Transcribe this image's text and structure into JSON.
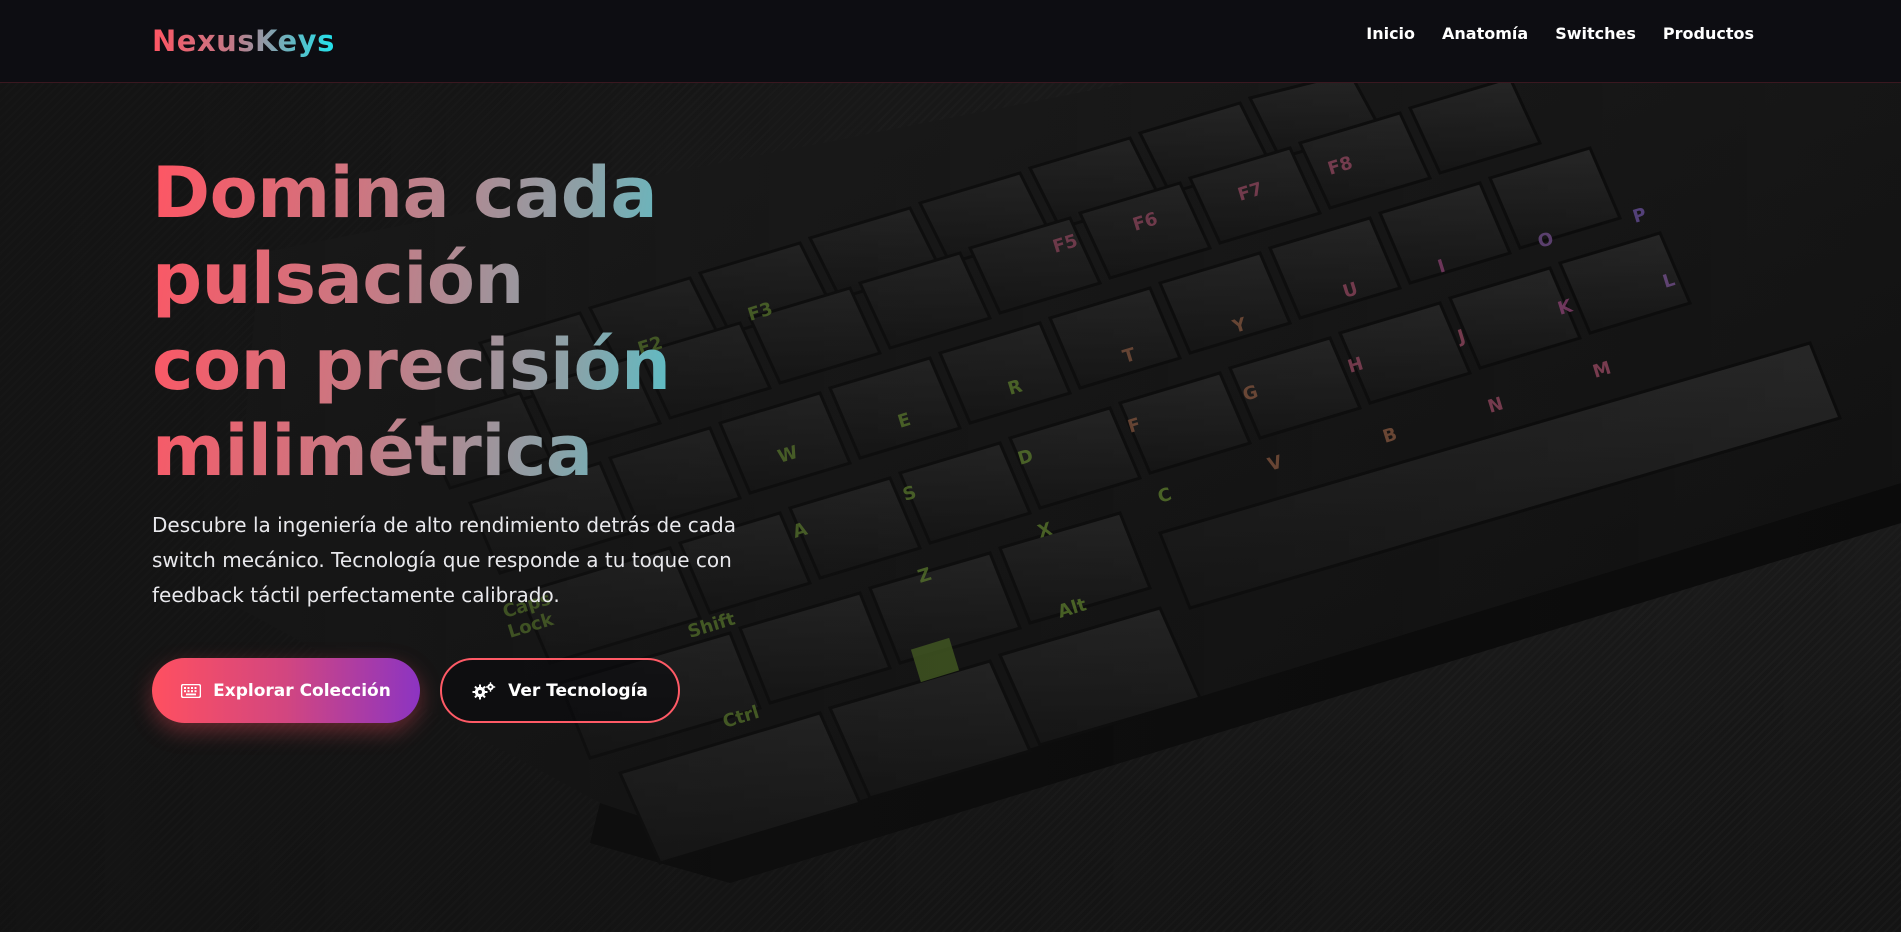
{
  "brand": {
    "logo": "NexusKeys",
    "colors": {
      "accent_red": "#ff5563",
      "accent_cyan": "#1fe4ee",
      "accent_purple": "#8c34c2"
    }
  },
  "nav": {
    "items": [
      {
        "label": "Inicio"
      },
      {
        "label": "Anatomía"
      },
      {
        "label": "Switches"
      },
      {
        "label": "Productos"
      }
    ]
  },
  "hero": {
    "headline_lines": [
      "Domina cada pulsación",
      "con precisión",
      "milimétrica"
    ],
    "subtitle": "Descubre la ingeniería de alto rendimiento detrás de cada switch mecánico. Tecnología que responde a tu toque con feedback táctil perfectamente calibrado.",
    "primary_cta": {
      "label": "Explorar Colección",
      "icon": "keyboard-icon"
    },
    "secondary_cta": {
      "label": "Ver Tecnología",
      "icon": "gears-icon"
    },
    "background": "mechanical-keyboard-photo"
  }
}
